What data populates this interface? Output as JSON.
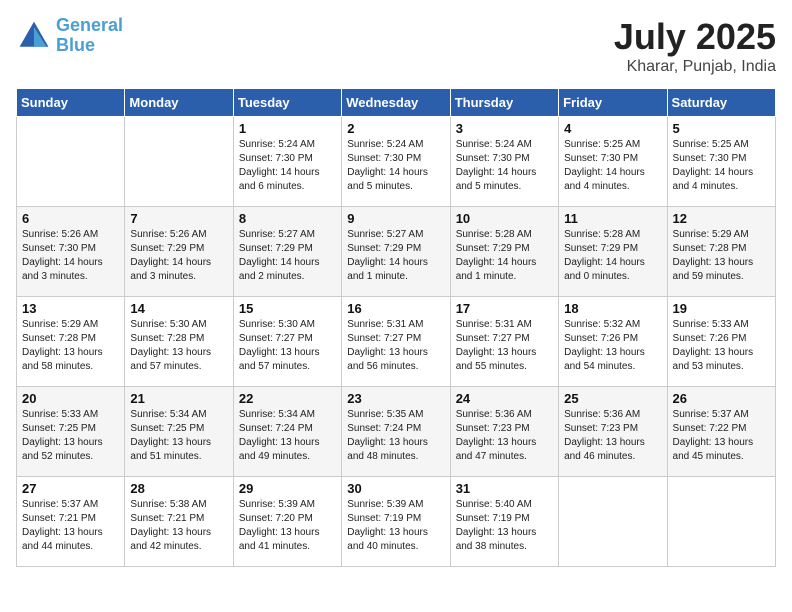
{
  "header": {
    "logo_line1": "General",
    "logo_line2": "Blue",
    "month": "July 2025",
    "location": "Kharar, Punjab, India"
  },
  "weekdays": [
    "Sunday",
    "Monday",
    "Tuesday",
    "Wednesday",
    "Thursday",
    "Friday",
    "Saturday"
  ],
  "weeks": [
    [
      {
        "day": "",
        "info": ""
      },
      {
        "day": "",
        "info": ""
      },
      {
        "day": "1",
        "info": "Sunrise: 5:24 AM\nSunset: 7:30 PM\nDaylight: 14 hours\nand 6 minutes."
      },
      {
        "day": "2",
        "info": "Sunrise: 5:24 AM\nSunset: 7:30 PM\nDaylight: 14 hours\nand 5 minutes."
      },
      {
        "day": "3",
        "info": "Sunrise: 5:24 AM\nSunset: 7:30 PM\nDaylight: 14 hours\nand 5 minutes."
      },
      {
        "day": "4",
        "info": "Sunrise: 5:25 AM\nSunset: 7:30 PM\nDaylight: 14 hours\nand 4 minutes."
      },
      {
        "day": "5",
        "info": "Sunrise: 5:25 AM\nSunset: 7:30 PM\nDaylight: 14 hours\nand 4 minutes."
      }
    ],
    [
      {
        "day": "6",
        "info": "Sunrise: 5:26 AM\nSunset: 7:30 PM\nDaylight: 14 hours\nand 3 minutes."
      },
      {
        "day": "7",
        "info": "Sunrise: 5:26 AM\nSunset: 7:29 PM\nDaylight: 14 hours\nand 3 minutes."
      },
      {
        "day": "8",
        "info": "Sunrise: 5:27 AM\nSunset: 7:29 PM\nDaylight: 14 hours\nand 2 minutes."
      },
      {
        "day": "9",
        "info": "Sunrise: 5:27 AM\nSunset: 7:29 PM\nDaylight: 14 hours\nand 1 minute."
      },
      {
        "day": "10",
        "info": "Sunrise: 5:28 AM\nSunset: 7:29 PM\nDaylight: 14 hours\nand 1 minute."
      },
      {
        "day": "11",
        "info": "Sunrise: 5:28 AM\nSunset: 7:29 PM\nDaylight: 14 hours\nand 0 minutes."
      },
      {
        "day": "12",
        "info": "Sunrise: 5:29 AM\nSunset: 7:28 PM\nDaylight: 13 hours\nand 59 minutes."
      }
    ],
    [
      {
        "day": "13",
        "info": "Sunrise: 5:29 AM\nSunset: 7:28 PM\nDaylight: 13 hours\nand 58 minutes."
      },
      {
        "day": "14",
        "info": "Sunrise: 5:30 AM\nSunset: 7:28 PM\nDaylight: 13 hours\nand 57 minutes."
      },
      {
        "day": "15",
        "info": "Sunrise: 5:30 AM\nSunset: 7:27 PM\nDaylight: 13 hours\nand 57 minutes."
      },
      {
        "day": "16",
        "info": "Sunrise: 5:31 AM\nSunset: 7:27 PM\nDaylight: 13 hours\nand 56 minutes."
      },
      {
        "day": "17",
        "info": "Sunrise: 5:31 AM\nSunset: 7:27 PM\nDaylight: 13 hours\nand 55 minutes."
      },
      {
        "day": "18",
        "info": "Sunrise: 5:32 AM\nSunset: 7:26 PM\nDaylight: 13 hours\nand 54 minutes."
      },
      {
        "day": "19",
        "info": "Sunrise: 5:33 AM\nSunset: 7:26 PM\nDaylight: 13 hours\nand 53 minutes."
      }
    ],
    [
      {
        "day": "20",
        "info": "Sunrise: 5:33 AM\nSunset: 7:25 PM\nDaylight: 13 hours\nand 52 minutes."
      },
      {
        "day": "21",
        "info": "Sunrise: 5:34 AM\nSunset: 7:25 PM\nDaylight: 13 hours\nand 51 minutes."
      },
      {
        "day": "22",
        "info": "Sunrise: 5:34 AM\nSunset: 7:24 PM\nDaylight: 13 hours\nand 49 minutes."
      },
      {
        "day": "23",
        "info": "Sunrise: 5:35 AM\nSunset: 7:24 PM\nDaylight: 13 hours\nand 48 minutes."
      },
      {
        "day": "24",
        "info": "Sunrise: 5:36 AM\nSunset: 7:23 PM\nDaylight: 13 hours\nand 47 minutes."
      },
      {
        "day": "25",
        "info": "Sunrise: 5:36 AM\nSunset: 7:23 PM\nDaylight: 13 hours\nand 46 minutes."
      },
      {
        "day": "26",
        "info": "Sunrise: 5:37 AM\nSunset: 7:22 PM\nDaylight: 13 hours\nand 45 minutes."
      }
    ],
    [
      {
        "day": "27",
        "info": "Sunrise: 5:37 AM\nSunset: 7:21 PM\nDaylight: 13 hours\nand 44 minutes."
      },
      {
        "day": "28",
        "info": "Sunrise: 5:38 AM\nSunset: 7:21 PM\nDaylight: 13 hours\nand 42 minutes."
      },
      {
        "day": "29",
        "info": "Sunrise: 5:39 AM\nSunset: 7:20 PM\nDaylight: 13 hours\nand 41 minutes."
      },
      {
        "day": "30",
        "info": "Sunrise: 5:39 AM\nSunset: 7:19 PM\nDaylight: 13 hours\nand 40 minutes."
      },
      {
        "day": "31",
        "info": "Sunrise: 5:40 AM\nSunset: 7:19 PM\nDaylight: 13 hours\nand 38 minutes."
      },
      {
        "day": "",
        "info": ""
      },
      {
        "day": "",
        "info": ""
      }
    ]
  ]
}
